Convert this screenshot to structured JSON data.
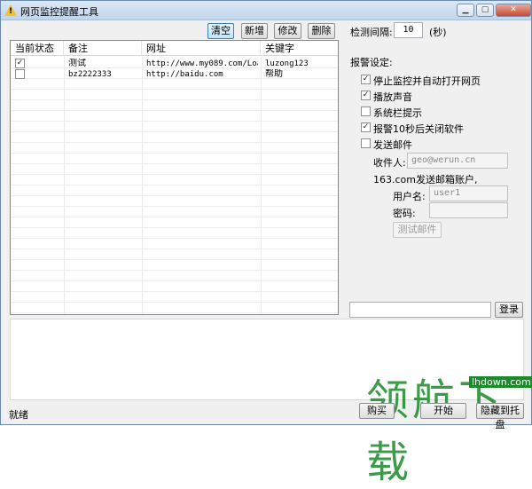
{
  "window": {
    "title": "网页监控提醒工具",
    "title_icon_glyph": "!"
  },
  "toolbar": {
    "clear_label": "清空",
    "add_label": "新增",
    "edit_label": "修改",
    "delete_label": "删除"
  },
  "interval": {
    "label": "检测间隔:",
    "value": "10",
    "unit": "(秒)"
  },
  "table": {
    "columns": [
      "当前状态",
      "备注",
      "网址",
      "关键字"
    ],
    "rows": [
      {
        "checked": true,
        "note": "测试",
        "url": "http://www.my089.com/Loan...",
        "keyword": "luzong123"
      },
      {
        "checked": false,
        "note": "bz2222333",
        "url": "http://baidu.com",
        "keyword": "帮助"
      }
    ]
  },
  "alarm": {
    "section_label": "报警设定:",
    "options": [
      {
        "label": "停止监控并自动打开网页",
        "checked": true
      },
      {
        "label": "播放声音",
        "checked": true
      },
      {
        "label": "系统栏提示",
        "checked": false
      },
      {
        "label": "报警10秒后关闭软件",
        "checked": true
      },
      {
        "label": "发送邮件",
        "checked": false
      }
    ],
    "recipient_label": "收件人:",
    "recipient_value": "geo@werun.cn",
    "account_label": "163.com发送邮箱账户,",
    "username_label": "用户名:",
    "username_value": "user1",
    "password_label": "密码:",
    "password_value": "",
    "test_mail_label": "测试邮件"
  },
  "login": {
    "input_value": "",
    "button_label": "登录"
  },
  "status": {
    "text": "就绪"
  },
  "bottom_buttons": {
    "buy_label": "购买",
    "start_label": "开始",
    "minimize_label": "隐藏到托盘"
  },
  "watermark": {
    "text": "领航下载",
    "url": "lhdown.com"
  }
}
